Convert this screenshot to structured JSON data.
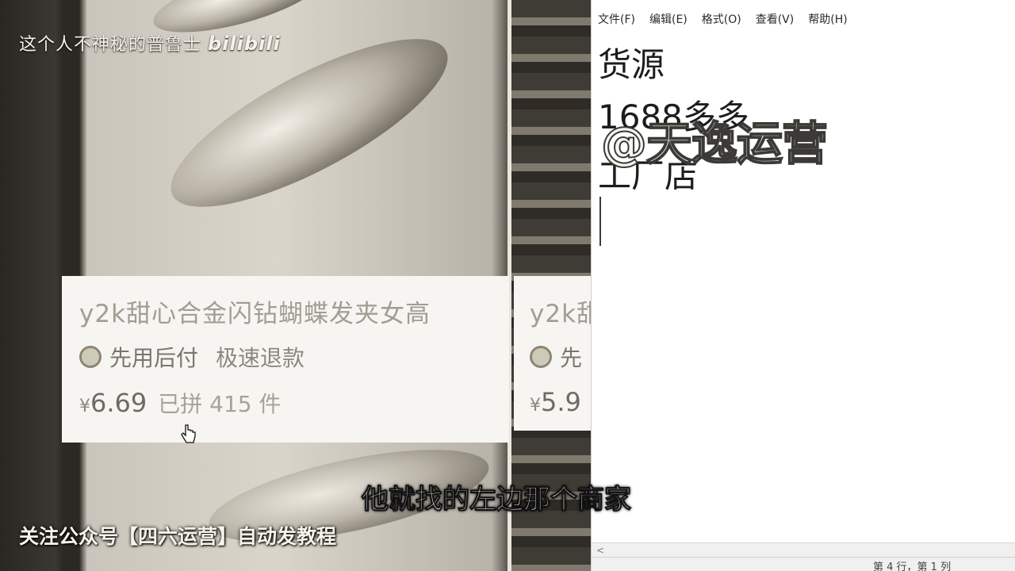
{
  "video_overlay": {
    "uploader_watermark": "这个人不神秘的普鲁士",
    "platform_logo_text": "bilibili",
    "subtitle": "他就找的左边那个商家",
    "bottom_watermark": "关注公众号【四六运营】自动发教程"
  },
  "product_card": {
    "title": "y2k甜心合金闪钻蝴蝶发夹女高",
    "pay_later": "先用后付",
    "refund": "极速退款",
    "currency": "¥",
    "price": "6.69",
    "sold": "已拼 415 件"
  },
  "product_card_2": {
    "title": "y2k甜",
    "pay_later": "先",
    "currency": "¥",
    "price": "5.9"
  },
  "notepad": {
    "menu": [
      "文件(F)",
      "编辑(E)",
      "格式(O)",
      "查看(V)",
      "帮助(H)"
    ],
    "lines": [
      "货源",
      "1688多多",
      "工厂店"
    ],
    "handle_overlay": "@天逸运营",
    "status_position": "第 4 行，第 1 列"
  },
  "colors": {
    "notepad_bg": "#ffffff",
    "card_bg": "#f6f5f2",
    "subtitle_text": "#ffffff"
  }
}
